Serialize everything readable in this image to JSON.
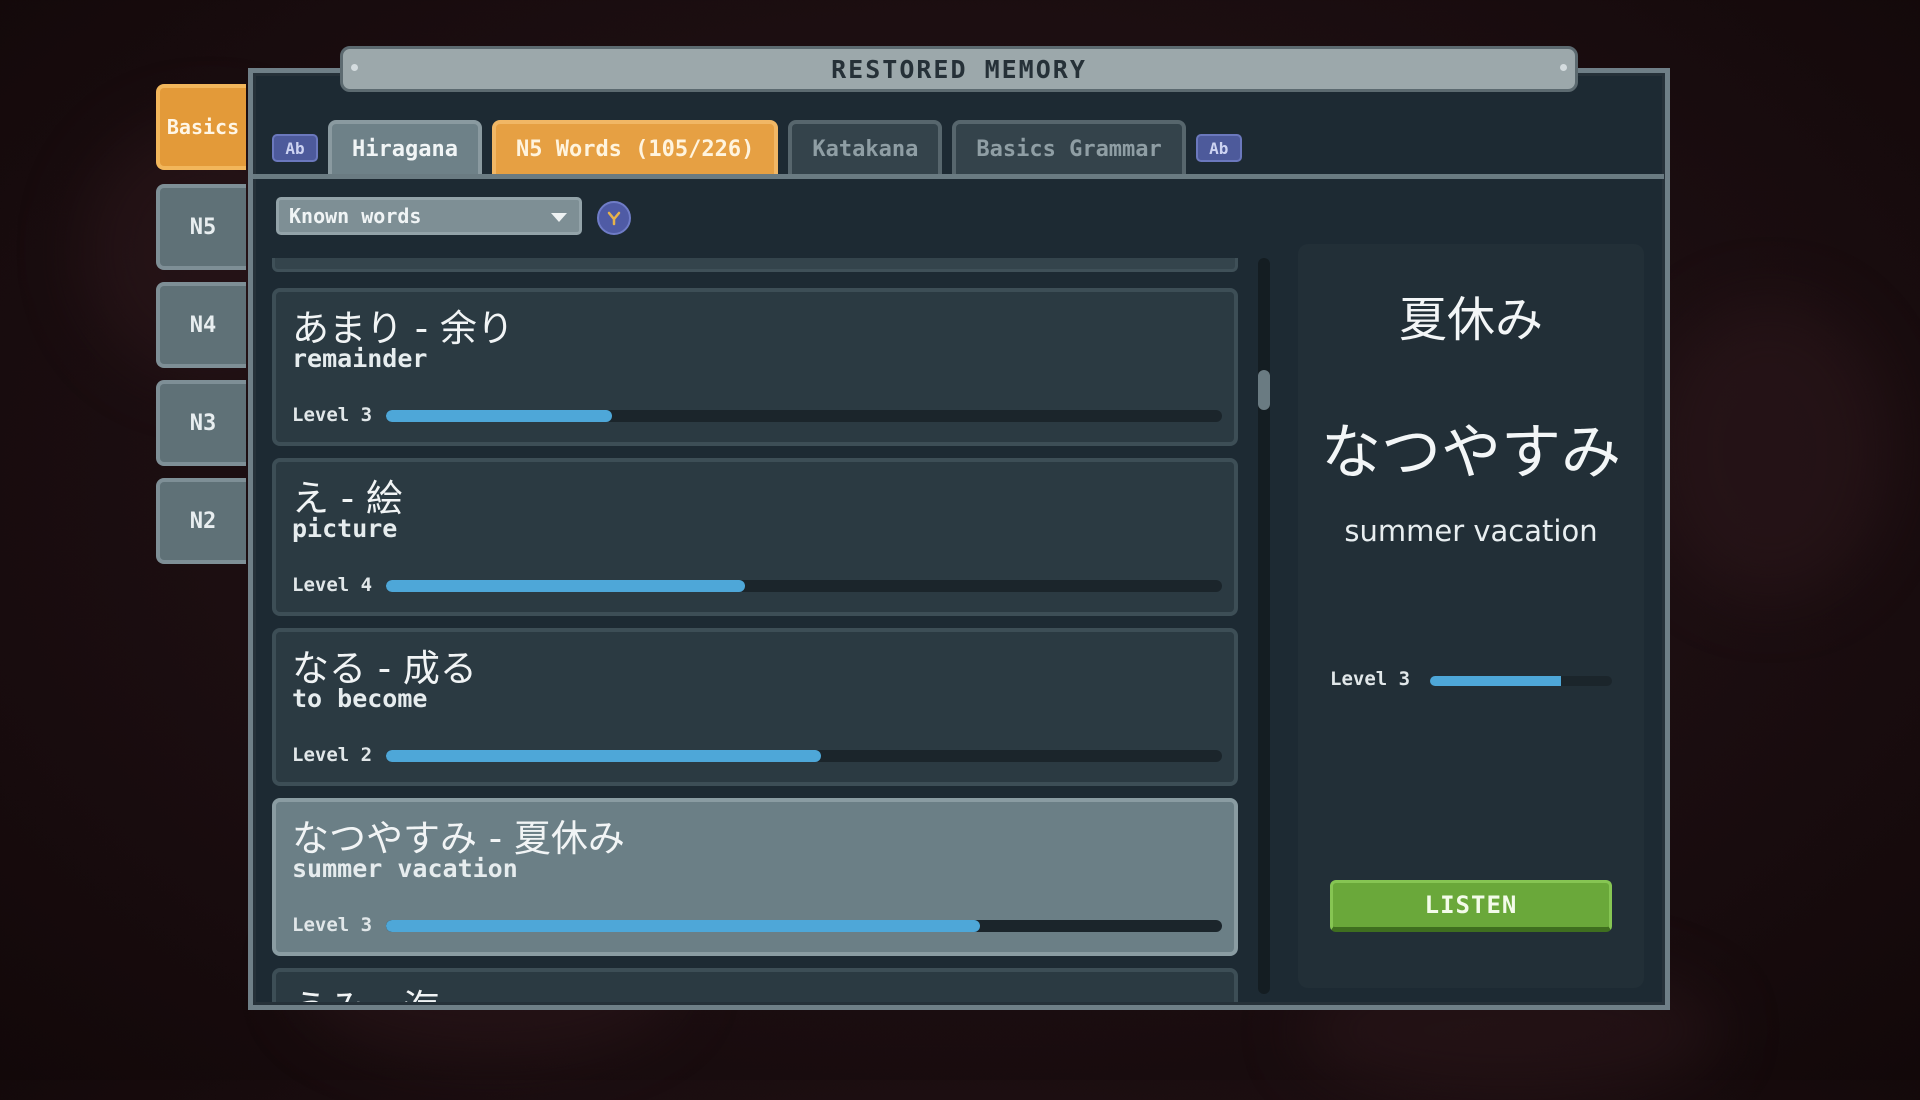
{
  "title": "RESTORED MEMORY",
  "side_tabs": [
    "Basics",
    "N5",
    "N4",
    "N3",
    "N2"
  ],
  "tab_badge": "Ab",
  "tabs": [
    "Hiragana",
    "N5 Words (105/226)",
    "Katakana",
    "Basics Grammar"
  ],
  "filter": {
    "selected": "Known words",
    "icon": "filter-icon"
  },
  "words": [
    {
      "jp": "あまり - 余り",
      "en": "remainder",
      "level": "Level 3",
      "progress": 0.27
    },
    {
      "jp": "え - 絵",
      "en": "picture",
      "level": "Level 4",
      "progress": 0.43
    },
    {
      "jp": "なる - 成る",
      "en": "to become",
      "level": "Level 2",
      "progress": 0.52
    },
    {
      "jp": "なつやすみ - 夏休み",
      "en": "summer vacation",
      "level": "Level 3",
      "progress": 0.71
    },
    {
      "jp": "うみ - 海",
      "en": "",
      "level": "",
      "progress": 0
    }
  ],
  "detail": {
    "kanji": "夏休み",
    "kana": "なつやすみ",
    "meaning": "summer vacation",
    "level": "Level 3",
    "progress": 0.72,
    "listen_label": "LISTEN"
  },
  "colors": {
    "accent": "#e6a043",
    "progress": "#4ea7d8",
    "listen": "#6aa83a"
  }
}
